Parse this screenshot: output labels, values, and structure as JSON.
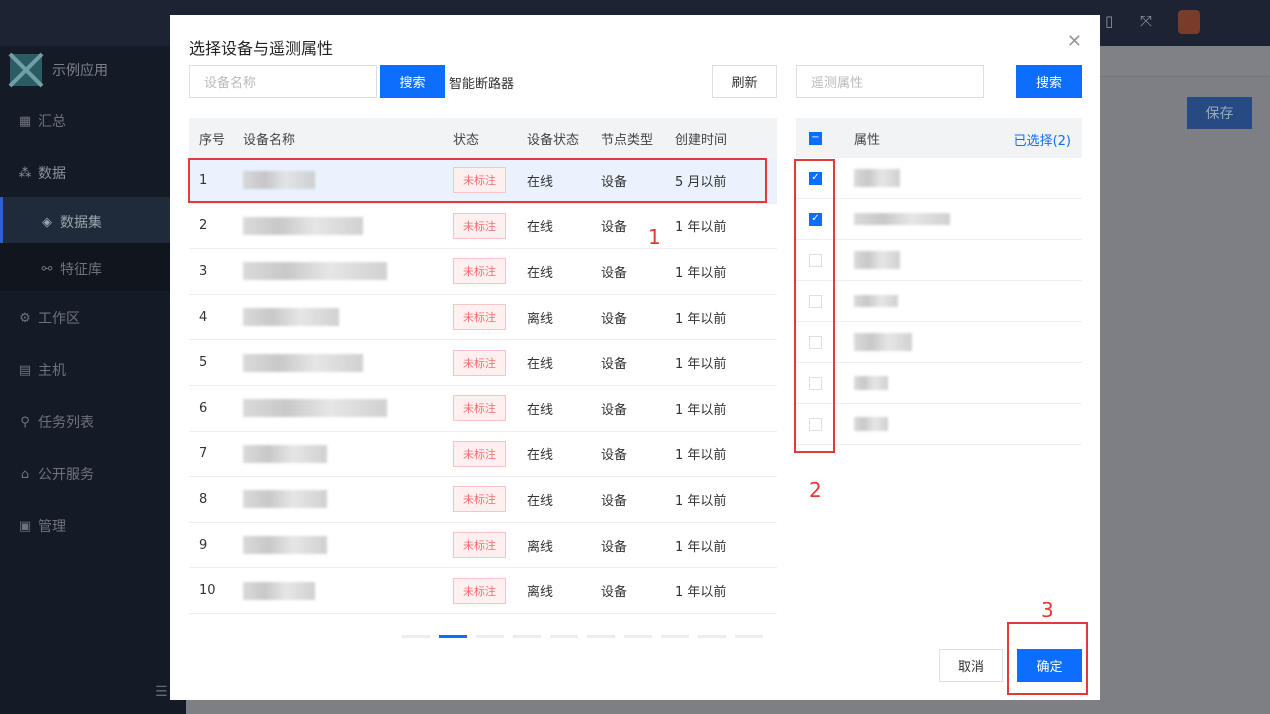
{
  "app": {
    "name": "示例应用",
    "save_label": "保存",
    "nav": [
      {
        "label": "汇总",
        "icon": "grid-icon"
      },
      {
        "label": "数据",
        "icon": "hierarchy-icon"
      },
      {
        "label": "数据集",
        "icon": "cube-icon"
      },
      {
        "label": "特征库",
        "icon": "feature-icon"
      },
      {
        "label": "工作区",
        "icon": "gear-icon"
      },
      {
        "label": "主机",
        "icon": "server-icon"
      },
      {
        "label": "任务列表",
        "icon": "task-icon"
      },
      {
        "label": "公开服务",
        "icon": "service-icon"
      },
      {
        "label": "管理",
        "icon": "admin-icon"
      }
    ]
  },
  "modal": {
    "title": "选择设备与遥测属性",
    "device_search_placeholder": "设备名称",
    "search_label": "搜索",
    "device_type_label": "智能断路器",
    "refresh_label": "刷新",
    "attr_search_placeholder": "遥测属性",
    "attr_search_label": "搜索",
    "cancel_label": "取消",
    "confirm_label": "确定",
    "columns": {
      "no": "序号",
      "name": "设备名称",
      "status": "状态",
      "device_status": "设备状态",
      "node_type": "节点类型",
      "created": "创建时间"
    },
    "rows": [
      {
        "no": "1",
        "status": "未标注",
        "device_status": "在线",
        "node_type": "设备",
        "created": "5 月以前"
      },
      {
        "no": "2",
        "status": "未标注",
        "device_status": "在线",
        "node_type": "设备",
        "created": "1 年以前"
      },
      {
        "no": "3",
        "status": "未标注",
        "device_status": "在线",
        "node_type": "设备",
        "created": "1 年以前"
      },
      {
        "no": "4",
        "status": "未标注",
        "device_status": "离线",
        "node_type": "设备",
        "created": "1 年以前"
      },
      {
        "no": "5",
        "status": "未标注",
        "device_status": "在线",
        "node_type": "设备",
        "created": "1 年以前"
      },
      {
        "no": "6",
        "status": "未标注",
        "device_status": "在线",
        "node_type": "设备",
        "created": "1 年以前"
      },
      {
        "no": "7",
        "status": "未标注",
        "device_status": "在线",
        "node_type": "设备",
        "created": "1 年以前"
      },
      {
        "no": "8",
        "status": "未标注",
        "device_status": "在线",
        "node_type": "设备",
        "created": "1 年以前"
      },
      {
        "no": "9",
        "status": "未标注",
        "device_status": "离线",
        "node_type": "设备",
        "created": "1 年以前"
      },
      {
        "no": "10",
        "status": "未标注",
        "device_status": "离线",
        "node_type": "设备",
        "created": "1 年以前"
      }
    ],
    "attr_header": "属性",
    "selected_count": "已选择(2)",
    "attr_rows": [
      {
        "checked": true
      },
      {
        "checked": true
      },
      {
        "checked": false
      },
      {
        "checked": false
      },
      {
        "checked": false
      },
      {
        "checked": false
      },
      {
        "checked": false
      }
    ]
  },
  "annotations": [
    "1",
    "2",
    "3"
  ],
  "colors": {
    "primary": "#0d6efd",
    "annotation": "#e53935",
    "tag_red": "#f56c6c"
  }
}
